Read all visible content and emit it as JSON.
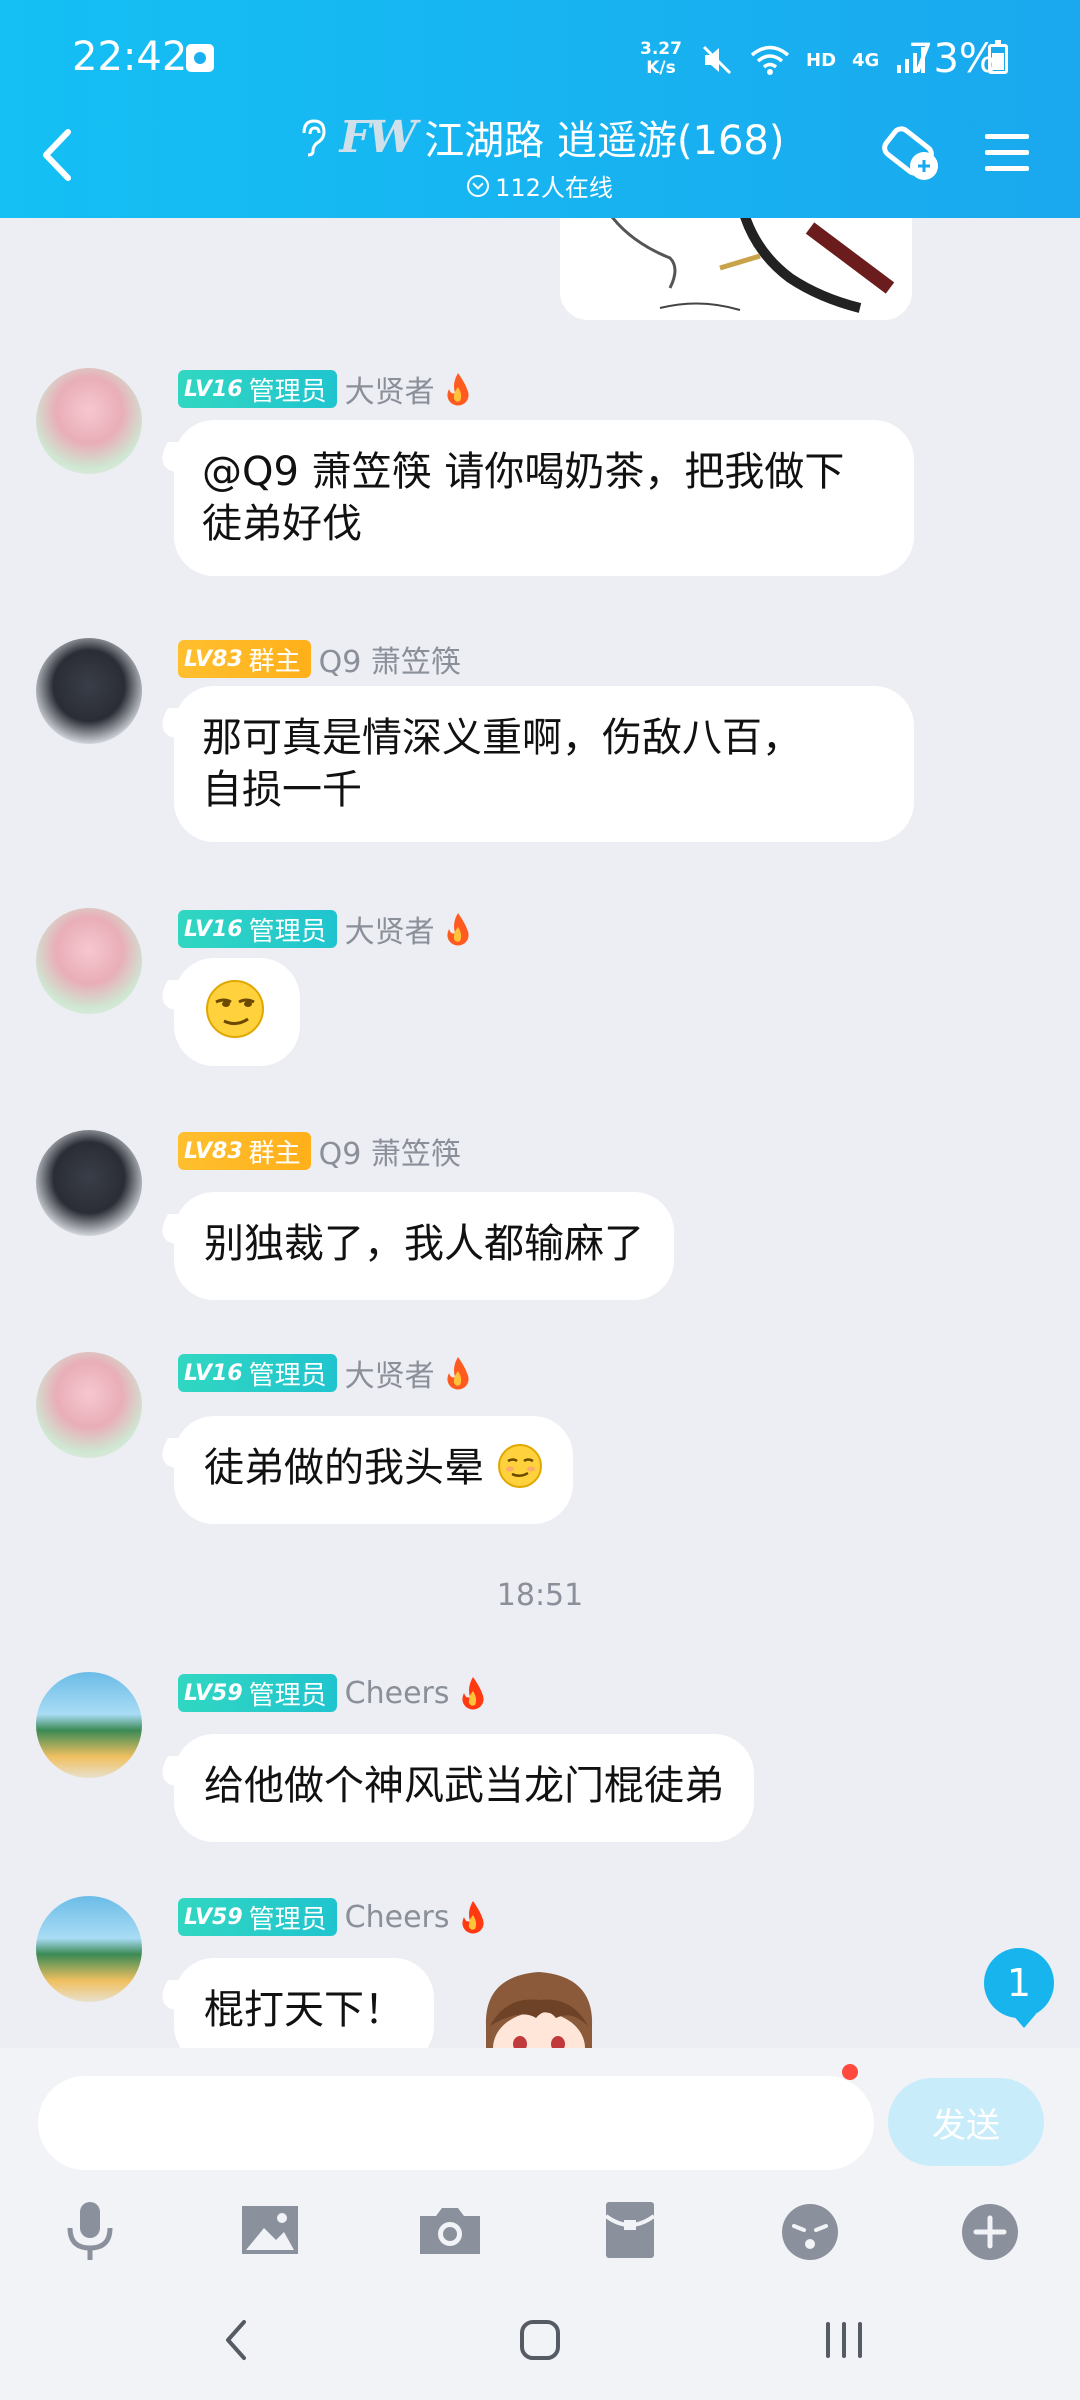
{
  "status_bar": {
    "time": "22:42",
    "net_speed_value": "3.27",
    "net_speed_unit": "K/s",
    "hd_label": "HD",
    "network_label": "4G",
    "battery": "73%"
  },
  "header": {
    "group_name": "江湖路 逍遥游(168)",
    "logo_text": "FW",
    "online_count": "112人在线"
  },
  "messages": [
    {
      "level": "LV16",
      "role": "管理员",
      "nick": "大贤者",
      "text": "@Q9 萧笠筷 请你喝奶茶，把我做下",
      "text2": "徒弟好伐"
    },
    {
      "level": "LV83",
      "role": "群主",
      "nick": "Q9 萧笠筷",
      "text": "那可真是情深义重啊，伤敌八百，",
      "text2": "自损一千"
    },
    {
      "level": "LV16",
      "role": "管理员",
      "nick": "大贤者",
      "emoji": "smirk-emoji"
    },
    {
      "level": "LV83",
      "role": "群主",
      "nick": "Q9 萧笠筷",
      "text": "别独裁了，我人都输麻了"
    },
    {
      "level": "LV16",
      "role": "管理员",
      "nick": "大贤者",
      "text": "徒弟做的我头晕"
    },
    {
      "level": "LV59",
      "role": "管理员",
      "nick": "Cheers",
      "text": "给他做个神风武当龙门棍徒弟"
    },
    {
      "level": "LV59",
      "role": "管理员",
      "nick": "Cheers",
      "text": "棍打天下！"
    }
  ],
  "time_separator": "18:51",
  "unread_count": "1",
  "composer": {
    "input_value": "",
    "send_label": "发送"
  },
  "toolbar_icons": [
    "microphone-icon",
    "image-icon",
    "camera-icon",
    "red-packet-icon",
    "emoji-icon",
    "plus-icon"
  ],
  "colors": {
    "header_bg": "#14c0f4",
    "admin_badge": "#2ccfc6",
    "owner_badge": "#ffb81f",
    "send_button": "#c8ecfa",
    "unread_badge": "#17b4ee"
  }
}
